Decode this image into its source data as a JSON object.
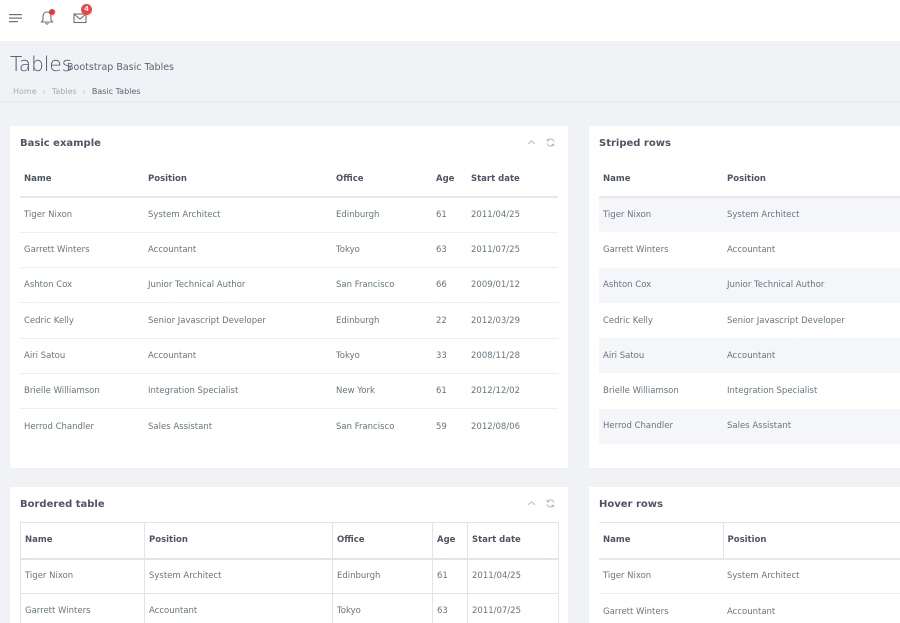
{
  "topbar": {
    "notifications_badge": "4"
  },
  "header": {
    "title": "Tables",
    "subtitle": "Bootstrap Basic Tables",
    "breadcrumb": [
      "Home",
      "Tables",
      "Basic Tables"
    ]
  },
  "columns": [
    "Name",
    "Position",
    "Office",
    "Age",
    "Start date"
  ],
  "rows": [
    [
      "Tiger Nixon",
      "System Architect",
      "Edinburgh",
      "61",
      "2011/04/25"
    ],
    [
      "Garrett Winters",
      "Accountant",
      "Tokyo",
      "63",
      "2011/07/25"
    ],
    [
      "Ashton Cox",
      "Junior Technical Author",
      "San Francisco",
      "66",
      "2009/01/12"
    ],
    [
      "Cedric Kelly",
      "Senior Javascript Developer",
      "Edinburgh",
      "22",
      "2012/03/29"
    ],
    [
      "Airi Satou",
      "Accountant",
      "Tokyo",
      "33",
      "2008/11/28"
    ],
    [
      "Brielle Williamson",
      "Integration Specialist",
      "New York",
      "61",
      "2012/12/02"
    ],
    [
      "Herrod Chandler",
      "Sales Assistant",
      "San Francisco",
      "59",
      "2012/08/06"
    ]
  ],
  "cards": {
    "basic": {
      "title": "Basic example"
    },
    "striped": {
      "title": "Striped rows"
    },
    "bordered": {
      "title": "Bordered table"
    },
    "hover": {
      "title": "Hover rows"
    }
  },
  "colors": {
    "badge": "#ee4444",
    "accent": "#4f5467"
  }
}
